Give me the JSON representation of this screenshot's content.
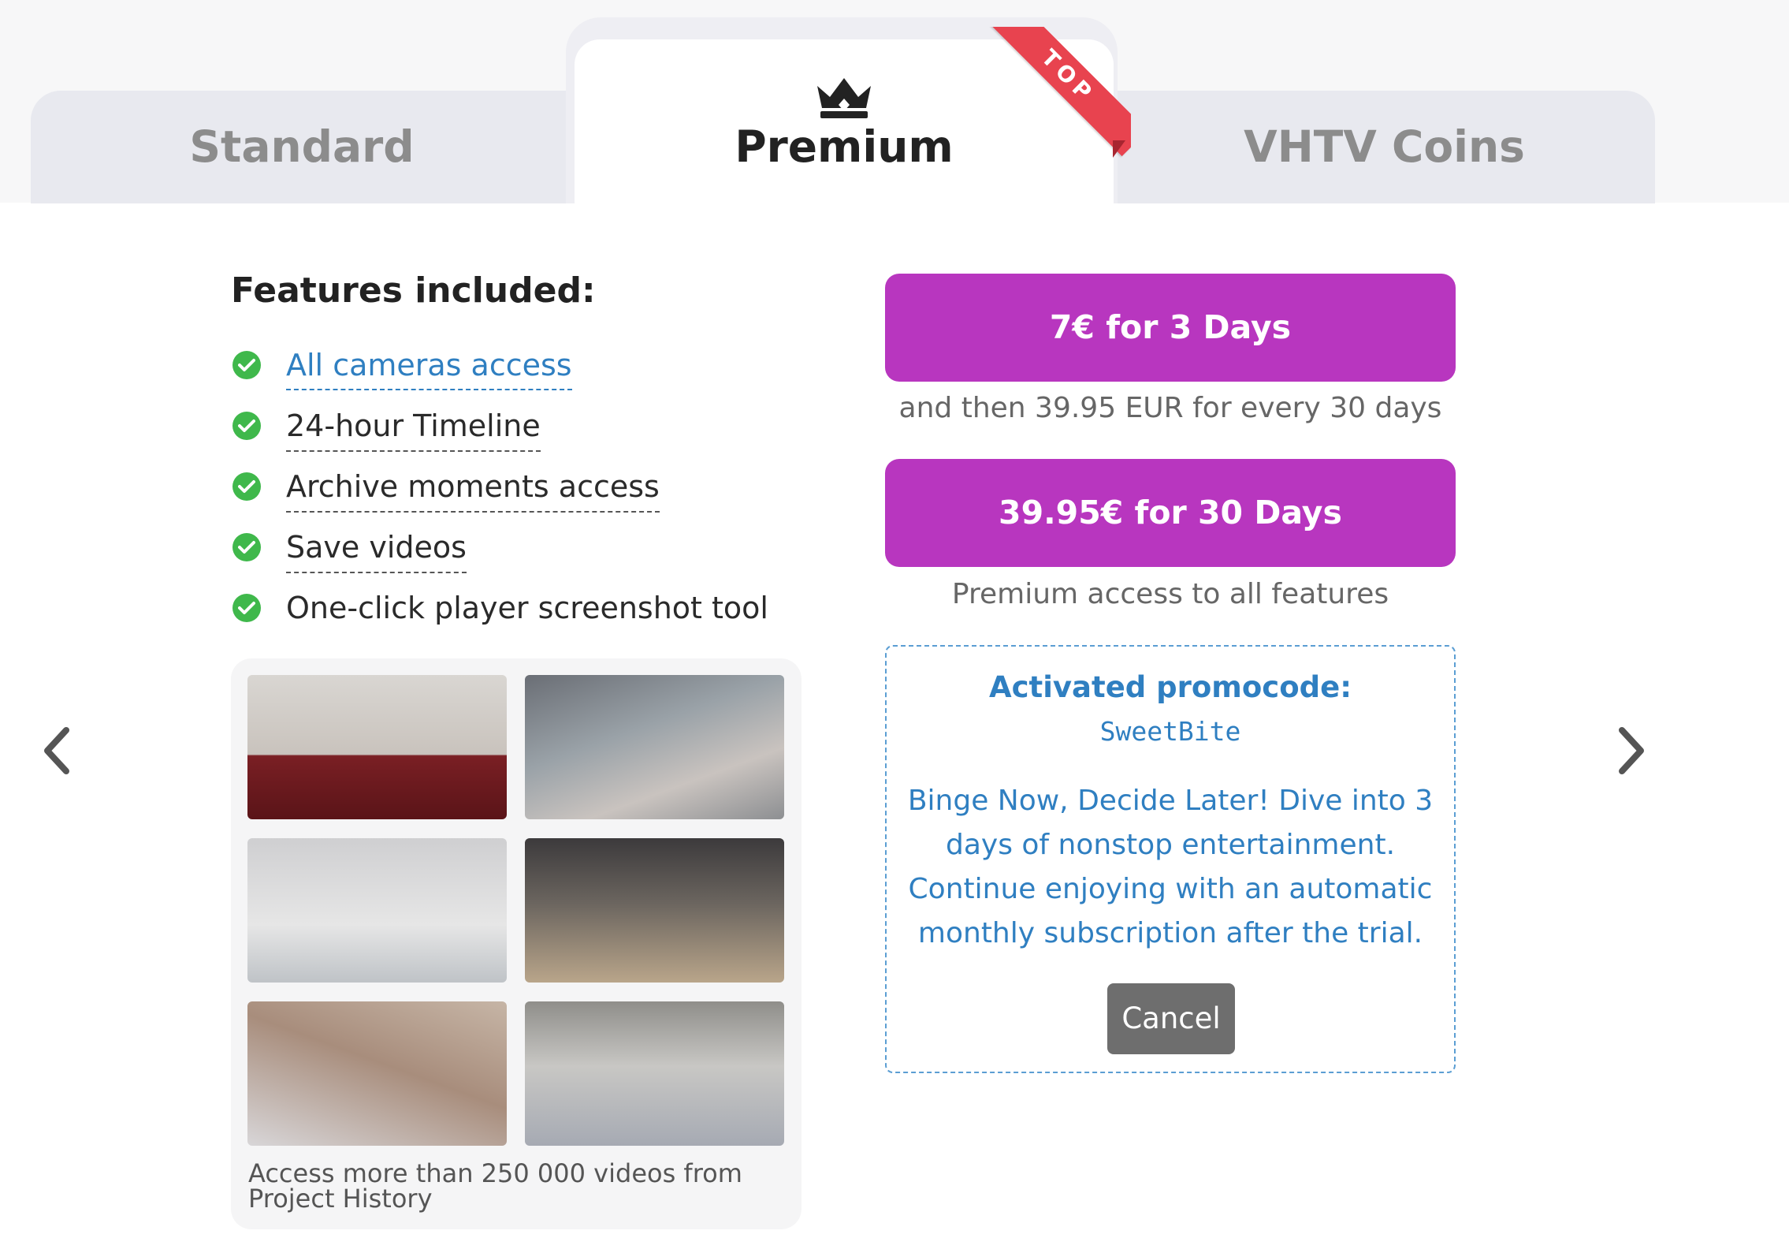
{
  "tabs": {
    "standard": "Standard",
    "premium": "Premium",
    "coins": "VHTV Coins",
    "top_ribbon": "TOP"
  },
  "features": {
    "title": "Features included:",
    "items": [
      {
        "label": "All cameras access"
      },
      {
        "label": "24-hour Timeline"
      },
      {
        "label": "Archive moments access"
      },
      {
        "label": "Save videos"
      },
      {
        "label": "One-click player screenshot tool"
      }
    ]
  },
  "gallery": {
    "caption": "Access more than 250 000 videos from Project History"
  },
  "plans": [
    {
      "button": "7€ for 3 Days",
      "subtitle": "and then 39.95 EUR for every 30 days"
    },
    {
      "button": "39.95€ for 30 Days",
      "subtitle": "Premium access to all features"
    }
  ],
  "promo": {
    "title": "Activated promocode:",
    "code": "SweetBite",
    "description": "Binge Now, Decide Later! Dive into 3 days of nonstop entertainment. Continue enjoying with an automatic monthly subscription after the trial.",
    "cancel": "Cancel"
  },
  "colors": {
    "accent_purple": "#b836bf",
    "link_blue": "#2f7fc1",
    "check_green": "#3fb84b",
    "ribbon_red": "#e8434f",
    "tab_gray": "#e8e9ef"
  },
  "icons": {
    "crown": "crown-icon",
    "check": "check-circle-icon",
    "prev": "chevron-left-icon",
    "next": "chevron-right-icon"
  }
}
